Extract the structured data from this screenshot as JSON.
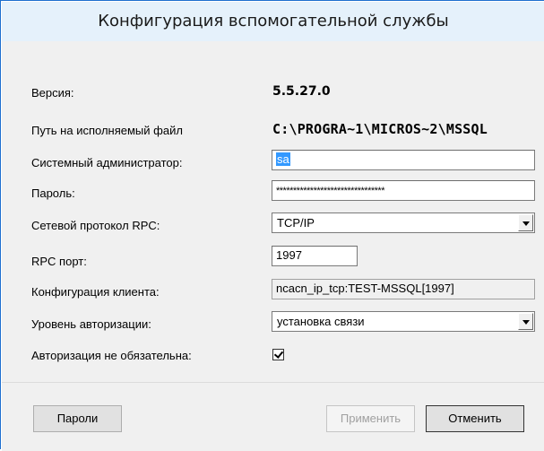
{
  "window": {
    "title": "Конфигурация вспомогательной службы"
  },
  "fields": {
    "version": {
      "label": "Версия:",
      "value": "5.5.27.0"
    },
    "path": {
      "label": "Путь на исполняемый файл",
      "value": "C:\\PROGRA~1\\MICROS~2\\MSSQL"
    },
    "admin": {
      "label": "Системный администратор:",
      "value": "sa"
    },
    "password": {
      "label": "Пароль:",
      "value": "********************************"
    },
    "rpc_protocol": {
      "label": "Сетевой протокол RPC:",
      "value": "TCP/IP"
    },
    "rpc_port": {
      "label": "RPC порт:",
      "value": "1997"
    },
    "client_config": {
      "label": "Конфигурация клиента:",
      "value": "ncacn_ip_tcp:TEST-MSSQL[1997]"
    },
    "auth_level": {
      "label": "Уровень авторизации:",
      "value": "установка связи"
    },
    "auth_optional": {
      "label": "Авторизация не обязательна:",
      "checked": true
    }
  },
  "buttons": {
    "passwords": "Пароли",
    "apply": "Применить",
    "cancel": "Отменить"
  }
}
